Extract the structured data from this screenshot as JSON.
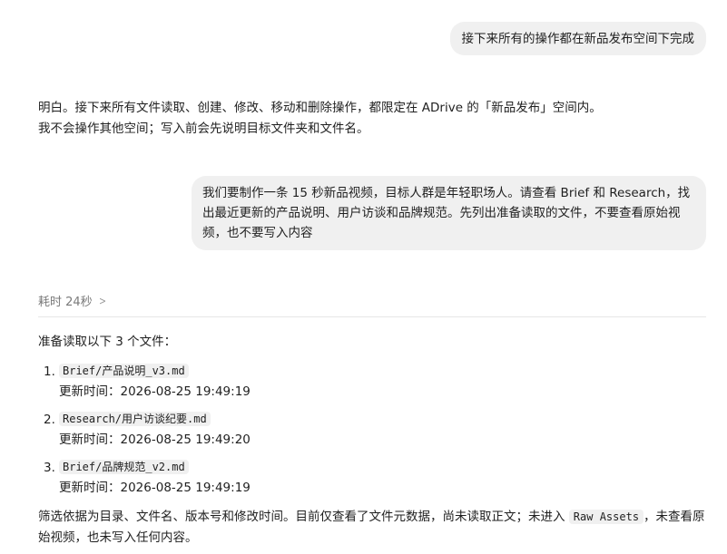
{
  "messages": {
    "user1": "接下来所有的操作都在新品发布空间下完成",
    "assistant1_line1": "明白。接下来所有文件读取、创建、修改、移动和删除操作，都限定在 ADrive 的「新品发布」空间内。",
    "assistant1_line2": "我不会操作其他空间；写入前会先说明目标文件夹和文件名。",
    "user2": "我们要制作一条 15 秒新品视频，目标人群是年轻职场人。请查看 Brief 和 Research，找出最近更新的产品说明、用户访谈和品牌规范。先列出准备读取的文件，不要查看原始视频，也不要写入内容"
  },
  "thinking": {
    "elapsed_label": "耗时 24秒",
    "chevron_icon": "chevron-right-icon"
  },
  "response": {
    "intro": "准备读取以下 3 个文件：",
    "files": [
      {
        "num": "1.",
        "path": "Brief/产品说明_v3.md",
        "time": "更新时间：2026-08-25 19:49:19"
      },
      {
        "num": "2.",
        "path": "Research/用户访谈纪要.md",
        "time": "更新时间：2026-08-25 19:49:20"
      },
      {
        "num": "3.",
        "path": "Brief/品牌规范_v2.md",
        "time": "更新时间：2026-08-25 19:49:19"
      }
    ],
    "summary_before": "筛选依据为目录、文件名、版本号和修改时间。目前仅查看了文件元数据，尚未读取正文；未进入 ",
    "summary_code": "Raw Assets",
    "summary_after": "，未查看原始视频，也未写入任何内容。"
  }
}
